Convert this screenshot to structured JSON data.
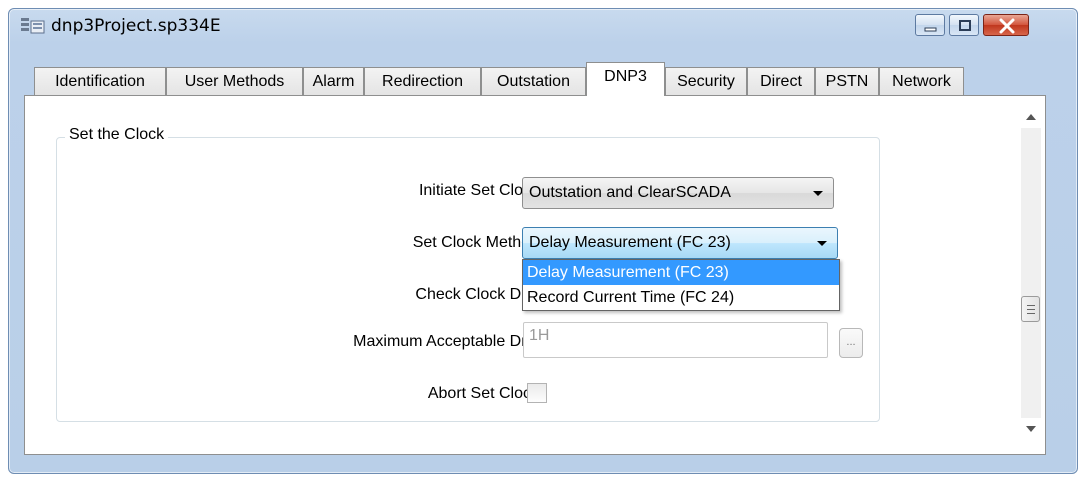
{
  "window": {
    "title": "dnp3Project.sp334E",
    "colors": {
      "titlebar": "#bcd1ea",
      "close": "#c0371e",
      "selection": "#3399ff"
    }
  },
  "tabs": [
    {
      "label": "Identification",
      "active": false
    },
    {
      "label": "User Methods",
      "active": false
    },
    {
      "label": "Alarm",
      "active": false
    },
    {
      "label": "Redirection",
      "active": false
    },
    {
      "label": "Outstation",
      "active": false
    },
    {
      "label": "DNP3",
      "active": true
    },
    {
      "label": "Security",
      "active": false
    },
    {
      "label": "Direct",
      "active": false
    },
    {
      "label": "PSTN",
      "active": false
    },
    {
      "label": "Network",
      "active": false
    }
  ],
  "group": {
    "title": "Set the Clock",
    "initiate": {
      "label": "Initiate Set Clock",
      "value": "Outstation and ClearSCADA"
    },
    "method": {
      "label": "Set Clock Method",
      "value": "Delay Measurement (FC 23)",
      "options": [
        "Delay Measurement (FC 23)",
        "Record Current Time (FC 24)"
      ]
    },
    "drift_check": {
      "label": "Check Clock Drift"
    },
    "max_drift": {
      "label": "Maximum Acceptable Drift",
      "value": "1H",
      "button": "..."
    },
    "abort": {
      "label": "Abort Set Clock",
      "checked": false
    }
  }
}
